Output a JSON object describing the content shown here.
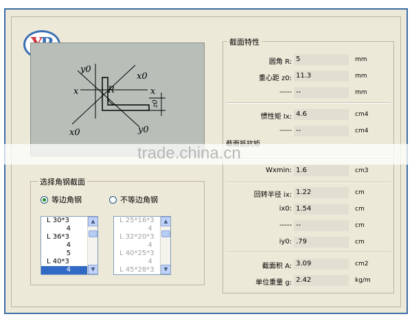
{
  "logo_text": {
    "y": "Y",
    "r": "R"
  },
  "drawing": {
    "labels": {
      "y0_top": "y0",
      "x0_top": "x0",
      "x_left": "x",
      "x_right": "x",
      "r": "R",
      "z0": "z0",
      "x0_bottom": "x0",
      "y0_bottom": "y0"
    }
  },
  "angle_group": {
    "title": "选择角钢截面",
    "radio_equal": "等边角钢",
    "radio_unequal": "不等边角钢",
    "equal_list": [
      "L 30*3",
      "         4",
      "L 36*3",
      "         4",
      "         5",
      "L 40*3",
      "         4"
    ],
    "equal_selected_index": 6,
    "unequal_list": [
      "L 25*16*3",
      "             4",
      "L 32*20*3",
      "             4",
      "L 40*25*3",
      "             4",
      "L 45*28*3"
    ]
  },
  "properties": {
    "title": "截面特性",
    "rows": [
      {
        "label": "圆角    R:",
        "value": "5",
        "unit": "mm"
      },
      {
        "label": "重心距  z0:",
        "value": "11.3",
        "unit": "mm"
      },
      {
        "label": "-----",
        "value": "--",
        "unit": "mm"
      },
      {
        "label": "惯性矩  Ix:",
        "value": "4.6",
        "unit": "cm4"
      },
      {
        "label": "-----",
        "value": "--",
        "unit": "cm4"
      },
      {
        "label": "截面抵抗矩",
        "value": "",
        "unit": ""
      },
      {
        "label": "Wxmin:",
        "value": "1.6",
        "unit": "cm3"
      },
      {
        "label": "回转半径  ix:",
        "value": "1.22",
        "unit": "cm"
      },
      {
        "label": "ix0:",
        "value": "1.54",
        "unit": "cm"
      },
      {
        "label": "-----",
        "value": "--",
        "unit": "cm"
      },
      {
        "label": "iy0:",
        "value": ".79",
        "unit": "cm"
      },
      {
        "label": "截面积  A:",
        "value": "3.09",
        "unit": "cm2"
      },
      {
        "label": "单位重量  g:",
        "value": "2.42",
        "unit": "kg/m"
      }
    ]
  },
  "watermark": "trade.china.cn"
}
